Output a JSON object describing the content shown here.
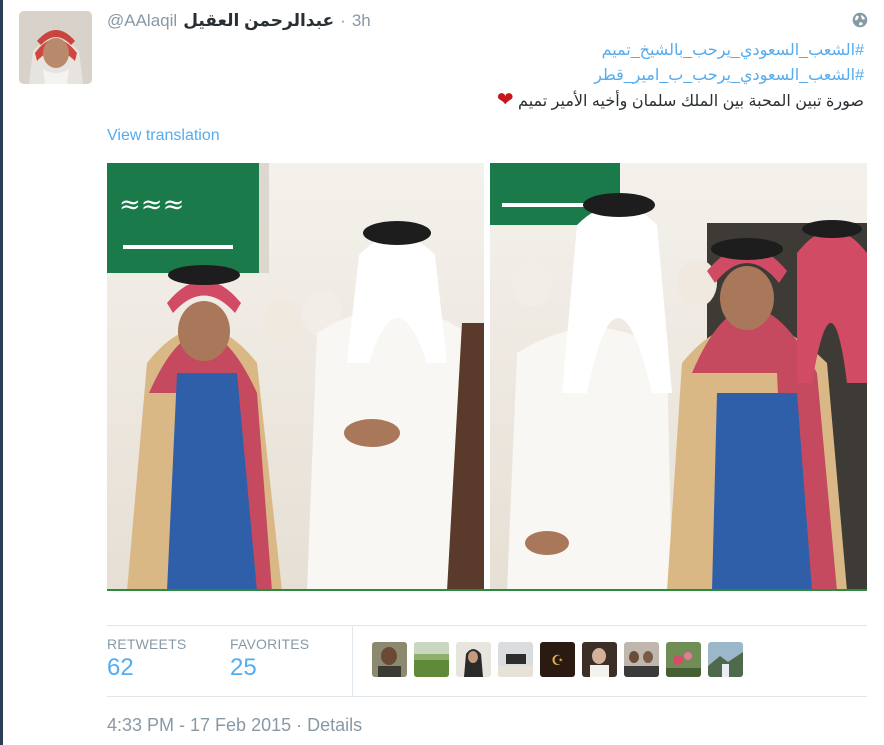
{
  "tweet": {
    "display_name": "عبدالرحمن العقيل",
    "handle": "@AAlaqil",
    "separator": "·",
    "time_ago": "3h",
    "hashtag_1": "#الشعب_السعودي_يرحب_بالشيخ_تميم",
    "hashtag_2": "#الشعب_السعودي_يرحب_ب_امير_قطر",
    "body_text": "صورة تبين المحبة بين الملك سلمان وأخيه الأمير تميم",
    "heart": "❤",
    "translate_label": "View translation"
  },
  "stats": {
    "retweets_label": "RETWEETS",
    "retweets_count": "62",
    "favorites_label": "FAVORITES",
    "favorites_count": "25"
  },
  "footer": {
    "timestamp": "4:33 PM - 17 Feb 2015",
    "separator": "·",
    "details_label": "Details"
  },
  "icons": {
    "globe": "globe-icon"
  },
  "colors": {
    "link": "#55acee",
    "muted": "#8899a6",
    "text": "#292f33",
    "heart": "#c4161c",
    "flag_green": "#1a7a4a"
  }
}
